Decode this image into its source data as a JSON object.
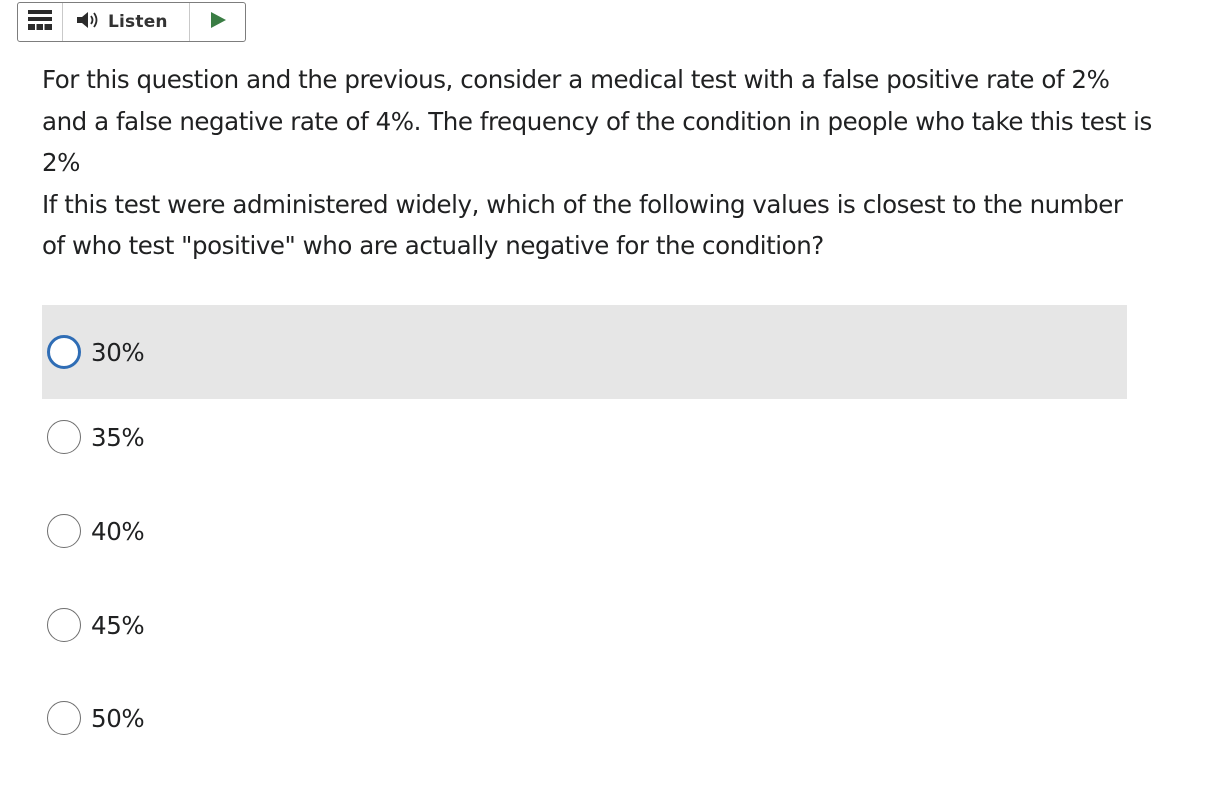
{
  "toolbar": {
    "menu_icon": "hamburger-menu-icon",
    "speaker_icon": "speaker-icon",
    "listen_label": "Listen",
    "play_icon": "play-icon",
    "play_color": "#3a7d44"
  },
  "question": {
    "line1": "For this question and the previous, consider a medical test with a false positive rate of 2% and a false negative rate of 4%. The frequency of the condition in people who take this test is 2%",
    "line2": "If this test were administered widely, which of the following values is closest to the number of who test \"positive\" who are actually negative for the condition?"
  },
  "choices": [
    {
      "label": "30%",
      "hovered": true,
      "focused": true
    },
    {
      "label": "35%",
      "hovered": false,
      "focused": false
    },
    {
      "label": "40%",
      "hovered": false,
      "focused": false
    },
    {
      "label": "45%",
      "hovered": false,
      "focused": false
    },
    {
      "label": "50%",
      "hovered": false,
      "focused": false
    }
  ],
  "colors": {
    "hover_background": "#e6e6e6",
    "focus_ring": "#2f6db5",
    "text": "#202122"
  }
}
